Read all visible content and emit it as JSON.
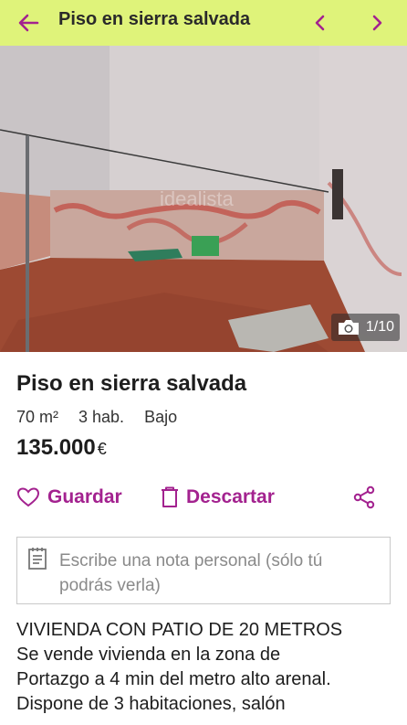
{
  "header": {
    "title": "Piso en sierra salvada",
    "colors": {
      "background": "#dff37a",
      "accent": "#a3228f"
    },
    "icons": {
      "back": "arrow-left-icon",
      "prev": "chevron-left-icon",
      "next": "chevron-right-icon"
    }
  },
  "gallery": {
    "watermark": "idealista",
    "counter": "1/10",
    "counter_icon": "camera-icon"
  },
  "listing": {
    "title": "Piso en sierra salvada",
    "area": "70 m²",
    "rooms": "3 hab.",
    "floor": "Bajo",
    "price": "135.000",
    "currency": "€"
  },
  "actions": {
    "save_label": "Guardar",
    "discard_label": "Descartar",
    "icons": {
      "save": "heart-icon",
      "discard": "trash-icon",
      "share": "share-icon"
    }
  },
  "note": {
    "placeholder": "Escribe una nota personal (sólo tú podrás verla)",
    "icon": "note-icon"
  },
  "description": {
    "lines": [
      "VIVIENDA CON PATIO DE 20 METROS",
      "Se vende vivienda en la zona de",
      "Portazgo a 4 min del metro alto arenal.",
      "Dispone de 3 habitaciones, salón"
    ]
  }
}
